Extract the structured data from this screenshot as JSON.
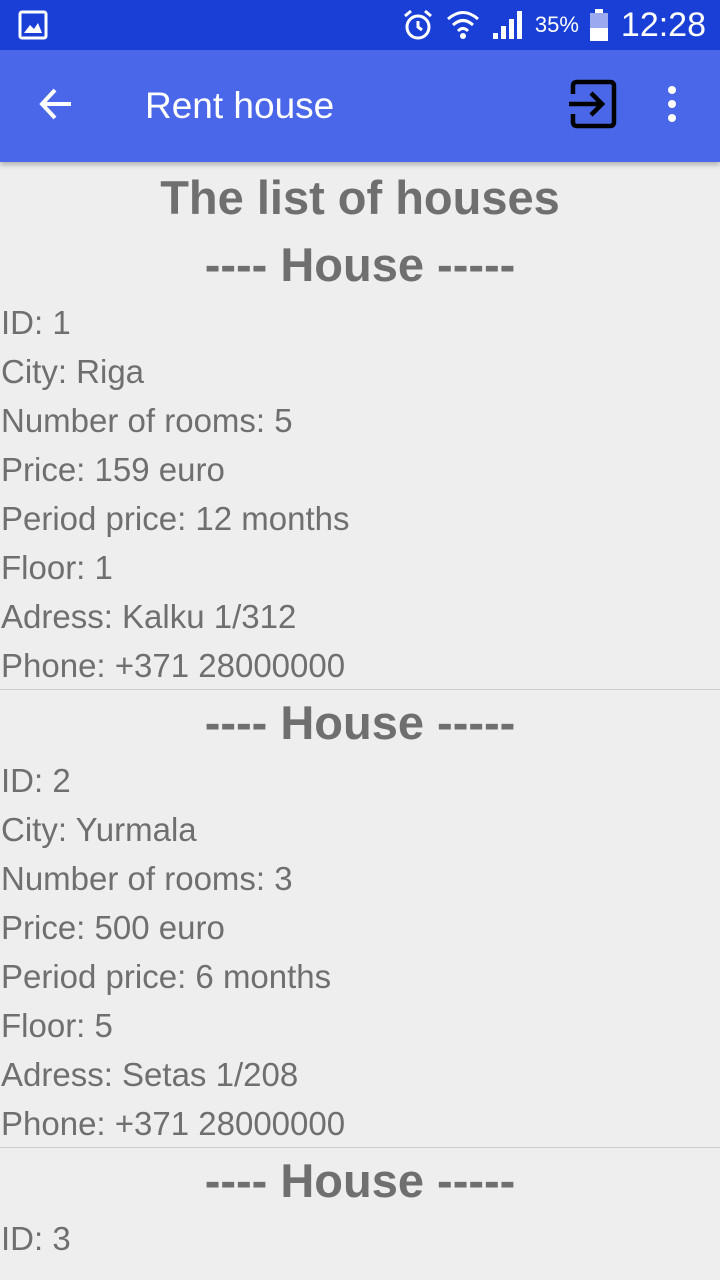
{
  "status_bar": {
    "left_icon": "gallery-notification-icon",
    "alarm_icon": "alarm-icon",
    "wifi_icon": "wifi-icon",
    "signal_icon": "cellular-signal-icon",
    "battery_percent": "35%",
    "battery_icon": "battery-icon",
    "time": "12:28"
  },
  "app_bar": {
    "back_icon": "arrow-left-icon",
    "title": "Rent house",
    "exit_icon": "exit-to-app-icon",
    "overflow_icon": "more-vert-icon"
  },
  "content": {
    "list_title": "The list of houses",
    "houses": [
      {
        "heading": "---- House -----",
        "id": "ID: 1",
        "city": "City: Riga",
        "rooms": "Number of rooms: 5",
        "price": "Price: 159 euro",
        "period": "Period price: 12 months",
        "floor": "Floor: 1",
        "address": "Adress: Kalku 1/312",
        "phone": "Phone: +371 28000000"
      },
      {
        "heading": "---- House -----",
        "id": "ID: 2",
        "city": "City: Yurmala",
        "rooms": "Number of rooms: 3",
        "price": "Price: 500 euro",
        "period": "Period price: 6 months",
        "floor": "Floor: 5",
        "address": "Adress: Setas 1/208",
        "phone": "Phone: +371 28000000"
      },
      {
        "heading": "---- House -----",
        "id": "ID: 3"
      }
    ]
  },
  "colors": {
    "status_bar": "#1a3fd6",
    "app_bar": "#4a67ea",
    "background": "#eeeeee",
    "text": "#6f6f6f",
    "divider": "#cfcfcf"
  }
}
